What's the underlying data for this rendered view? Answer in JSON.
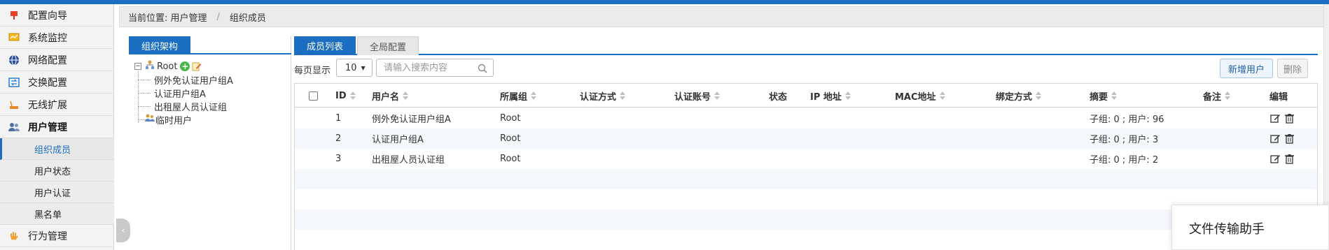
{
  "sidebar": {
    "items": [
      {
        "label": "配置向导",
        "icon": "flag-icon"
      },
      {
        "label": "系统监控",
        "icon": "monitor-icon"
      },
      {
        "label": "网络配置",
        "icon": "globe-icon"
      },
      {
        "label": "交换配置",
        "icon": "switch-icon"
      },
      {
        "label": "无线扩展",
        "icon": "wireless-icon"
      },
      {
        "label": "用户管理",
        "icon": "users-icon"
      }
    ],
    "sub_items": [
      {
        "label": "组织成员",
        "active": true
      },
      {
        "label": "用户状态"
      },
      {
        "label": "用户认证"
      },
      {
        "label": "黑名单"
      }
    ],
    "last_item": {
      "label": "行为管理",
      "icon": "hand-icon"
    }
  },
  "breadcrumb": {
    "prefix": "当前位置: 用户管理",
    "separator": "/",
    "current": "组织成员"
  },
  "org_panel": {
    "tab_label": "组织架构",
    "tree": {
      "root": "Root",
      "children": [
        "例外免认证用户组A",
        "认证用户组A",
        "出租屋人员认证组"
      ],
      "temp": "临时用户"
    }
  },
  "member_panel": {
    "tabs": [
      {
        "label": "成员列表",
        "active": true
      },
      {
        "label": "全局配置",
        "active": false
      }
    ],
    "toolbar": {
      "per_page_label": "每页显示",
      "per_page_value": "10",
      "search_placeholder": "请输入搜索内容",
      "add_button": "新增用户",
      "delete_button": "删除"
    },
    "columns": [
      "ID",
      "用户名",
      "所属组",
      "认证方式",
      "认证账号",
      "状态",
      "IP 地址",
      "MAC地址",
      "绑定方式",
      "摘要",
      "备注",
      "编辑"
    ],
    "rows": [
      {
        "id": "1",
        "username": "例外免认证用户组A",
        "group": "Root",
        "summary": "子组: 0 ; 用户: 96"
      },
      {
        "id": "2",
        "username": "认证用户组A",
        "group": "Root",
        "summary": "子组: 0 ; 用户: 3"
      },
      {
        "id": "3",
        "username": "出租屋人员认证组",
        "group": "Root",
        "summary": "子组: 0 ; 用户: 2"
      }
    ]
  },
  "popup": {
    "title": "文件传输助手"
  },
  "colors": {
    "accent": "#1b6ec2",
    "add_green": "#47b847"
  }
}
